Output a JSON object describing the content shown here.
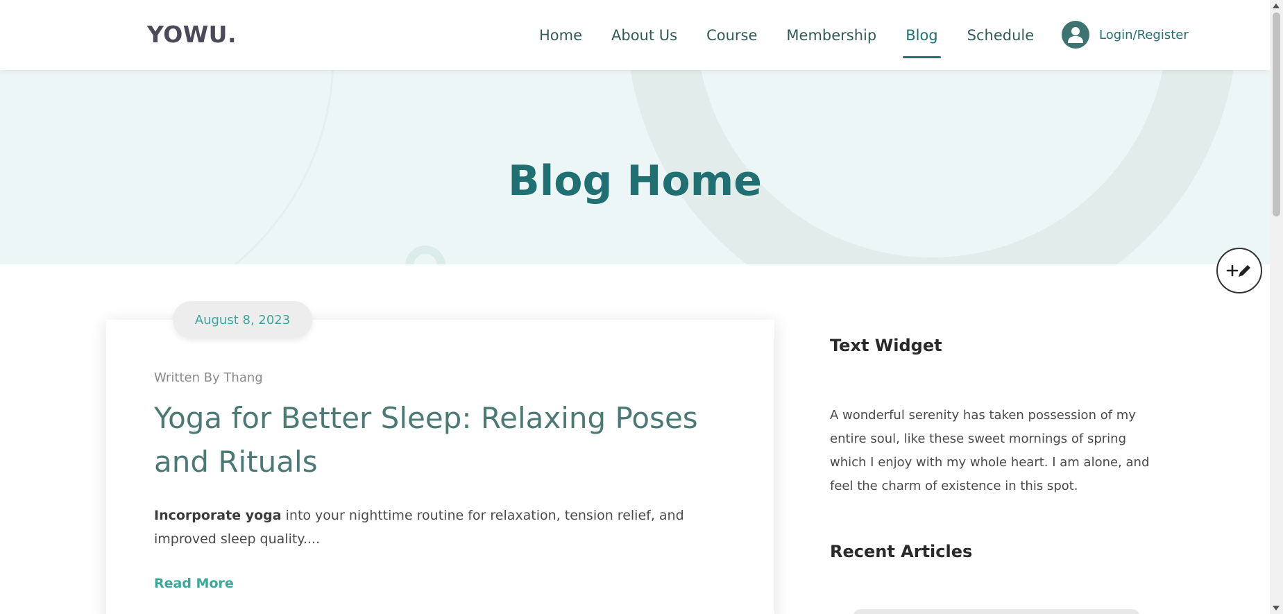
{
  "header": {
    "logo": "YOWU.",
    "nav": [
      {
        "label": "Home",
        "active": false
      },
      {
        "label": "About Us",
        "active": false
      },
      {
        "label": "Course",
        "active": false
      },
      {
        "label": "Membership",
        "active": false
      },
      {
        "label": "Blog",
        "active": true
      },
      {
        "label": "Schedule",
        "active": false
      }
    ],
    "account_label": "Login/Register",
    "account_icon": "user-icon"
  },
  "hero": {
    "title": "Blog Home"
  },
  "fab": {
    "icon": "add-edit-icon"
  },
  "post": {
    "date": "August 8, 2023",
    "author": "Written By Thang",
    "title": "Yoga for Better Sleep: Relaxing Poses and Rituals",
    "excerpt_bold": "Incorporate yoga",
    "excerpt_rest": " into your nighttime routine for relaxation, tension relief, and improved sleep quality....",
    "read_more": "Read More"
  },
  "sidebar": {
    "text_widget_title": "Text Widget",
    "text_widget_body": "A wonderful serenity has taken possession of my entire soul, like these sweet mornings of spring which I enjoy with my whole heart. I am alone, and feel the charm of existence in this spot.",
    "recent_title": "Recent Articles"
  },
  "colors": {
    "brand": "#1f6f73",
    "accent": "#3aa89a",
    "hero_bg": "#edf6f6"
  }
}
